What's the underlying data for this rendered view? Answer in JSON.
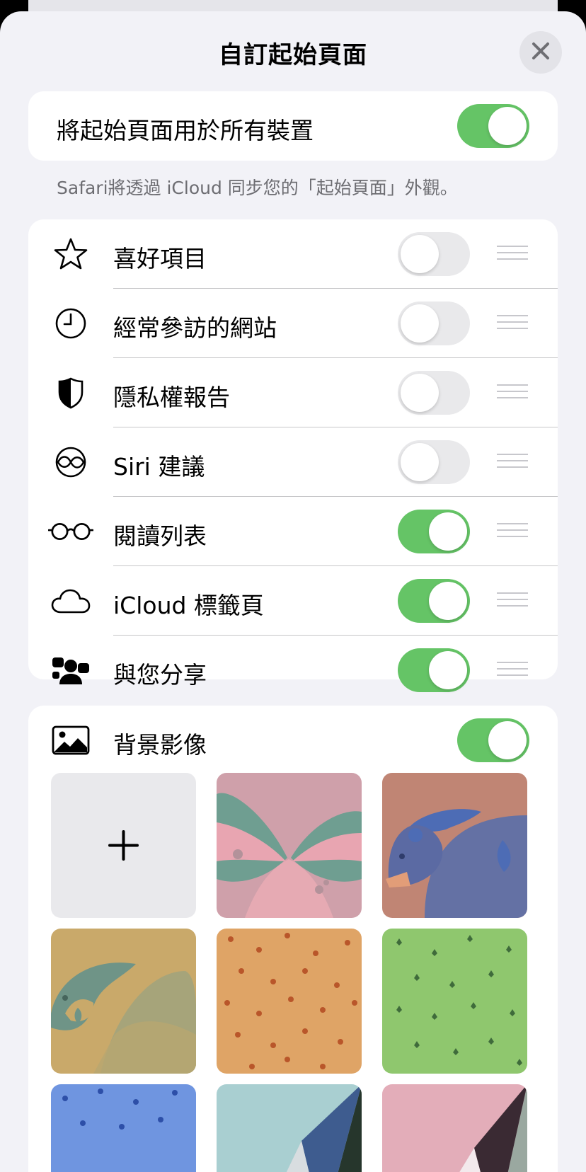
{
  "sheet": {
    "title": "自訂起始頁面",
    "close_icon": "close-icon"
  },
  "all_devices": {
    "label": "將起始頁面用於所有裝置",
    "enabled": true
  },
  "footnote": "Safari將透過 iCloud 同步您的「起始頁面」外觀。",
  "sections": [
    {
      "label": "喜好項目",
      "icon": "star-icon",
      "enabled": false
    },
    {
      "label": "經常參訪的網站",
      "icon": "clock-icon",
      "enabled": false
    },
    {
      "label": "隱私權報告",
      "icon": "shield-icon",
      "enabled": false
    },
    {
      "label": "Siri 建議",
      "icon": "siri-icon",
      "enabled": false
    },
    {
      "label": "閱讀列表",
      "icon": "glasses-icon",
      "enabled": true
    },
    {
      "label": "iCloud 標籤頁",
      "icon": "cloud-icon",
      "enabled": true
    },
    {
      "label": "與您分享",
      "icon": "shared-with-you-icon",
      "enabled": true
    }
  ],
  "background_image": {
    "label": "背景影像",
    "icon": "photo-icon",
    "enabled": true,
    "tiles": [
      "add-tile",
      "butterfly",
      "bear",
      "parrot",
      "orange-pattern",
      "green-pattern",
      "blue-pattern",
      "teal-triangle",
      "pink-triangle"
    ]
  },
  "colors": {
    "accent_green": "#65c466",
    "sheet_background": "#f2f2f7",
    "card_background": "#ffffff",
    "secondary_text": "#6d6d72",
    "separator": "#c6c6c8"
  }
}
